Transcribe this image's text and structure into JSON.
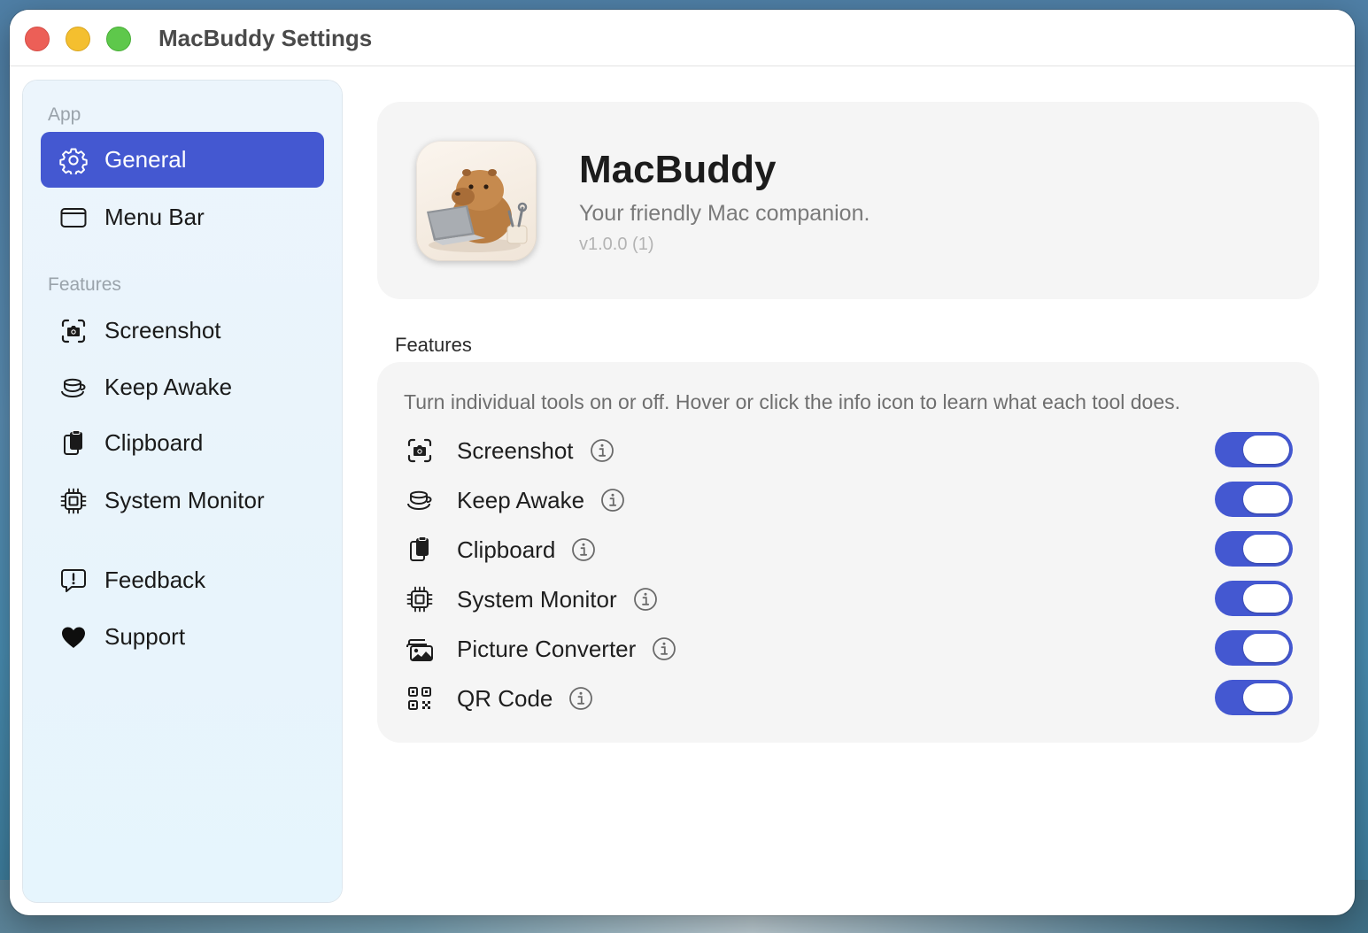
{
  "window": {
    "title": "MacBuddy Settings"
  },
  "sidebar": {
    "sections": [
      {
        "label": "App"
      },
      {
        "label": "Features"
      }
    ],
    "items": [
      {
        "label": "General",
        "icon": "gear-icon"
      },
      {
        "label": "Menu Bar",
        "icon": "menubar-icon"
      },
      {
        "label": "Screenshot",
        "icon": "camera-viewfinder-icon"
      },
      {
        "label": "Keep Awake",
        "icon": "cup-icon"
      },
      {
        "label": "Clipboard",
        "icon": "clipboard-icon"
      },
      {
        "label": "System Monitor",
        "icon": "cpu-icon"
      },
      {
        "label": "Feedback",
        "icon": "exclamation-bubble-icon"
      },
      {
        "label": "Support",
        "icon": "heart-icon"
      }
    ],
    "active": "General"
  },
  "app": {
    "name": "MacBuddy",
    "tagline": "Your friendly Mac companion.",
    "version": "v1.0.0 (1)"
  },
  "features": {
    "heading": "Features",
    "description": "Turn individual tools on or off. Hover or click the info icon to learn what each tool does.",
    "items": [
      {
        "label": "Screenshot",
        "icon": "camera-viewfinder-icon",
        "enabled": true
      },
      {
        "label": "Keep Awake",
        "icon": "cup-icon",
        "enabled": true
      },
      {
        "label": "Clipboard",
        "icon": "clipboard-icon",
        "enabled": true
      },
      {
        "label": "System Monitor",
        "icon": "cpu-icon",
        "enabled": true
      },
      {
        "label": "Picture Converter",
        "icon": "photo-stack-icon",
        "enabled": true
      },
      {
        "label": "QR Code",
        "icon": "qr-code-icon",
        "enabled": true
      }
    ]
  },
  "colors": {
    "accent": "#4458d1",
    "sidebar_bg": "#ecf5fc",
    "card_bg": "#f5f5f5"
  }
}
